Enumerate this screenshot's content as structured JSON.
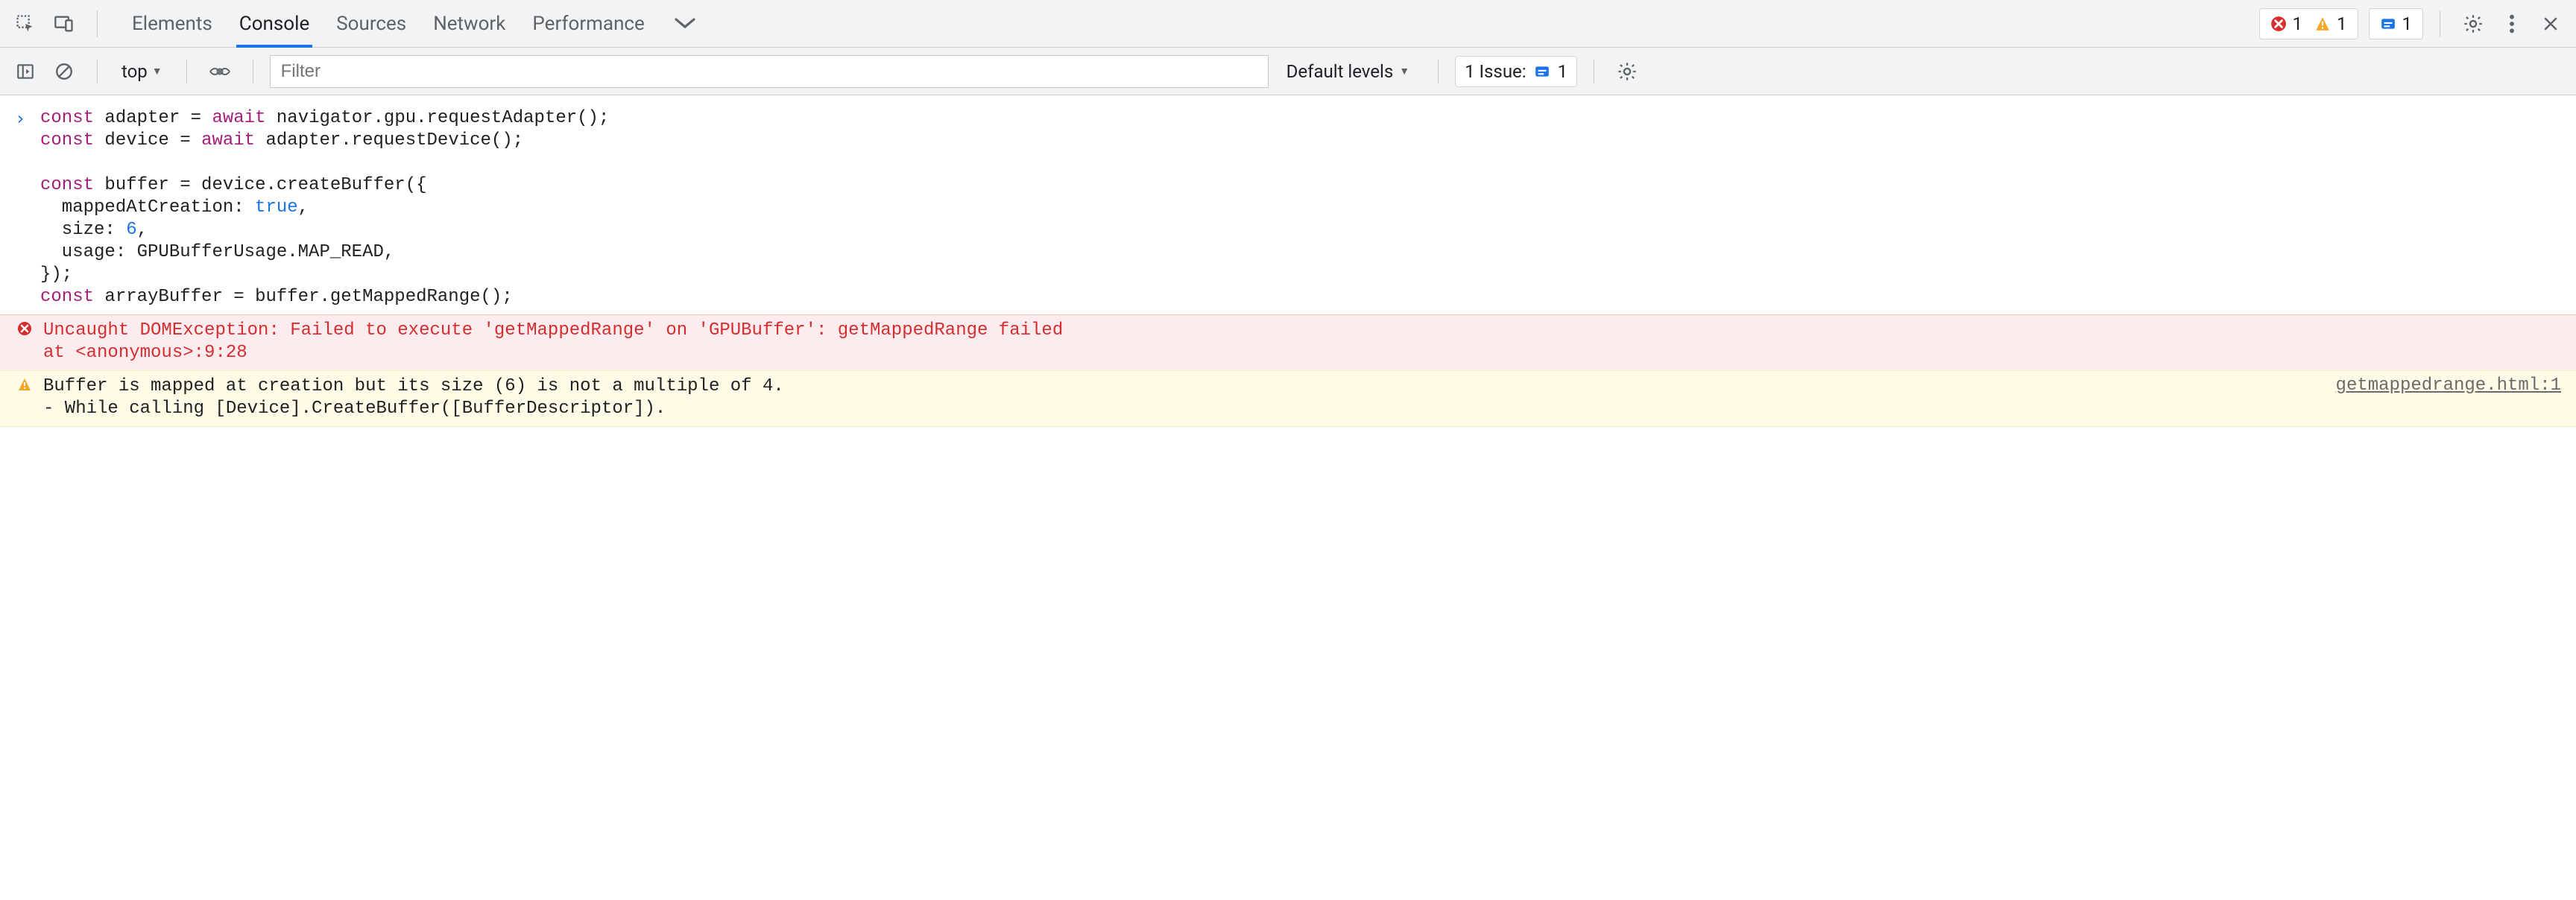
{
  "topbar": {
    "tabs": {
      "elements": "Elements",
      "console": "Console",
      "sources": "Sources",
      "network": "Network",
      "performance": "Performance"
    },
    "counts": {
      "errors": "1",
      "warnings": "1",
      "info": "1"
    }
  },
  "toolbar": {
    "scope": "top",
    "filter_placeholder": "Filter",
    "levels_label": "Default levels",
    "issues_label": "1 Issue:",
    "issues_count": "1"
  },
  "code": {
    "c1": "const",
    "sp": " ",
    "adapter": "adapter",
    "eq": " = ",
    "await": "await",
    "reqAdapter": " navigator.gpu.requestAdapter();",
    "device": "device",
    "reqDevice": " adapter.requestDevice();",
    "buffer": "buffer",
    "createBuf": " = device.createBuffer({",
    "mapLabel": "  mappedAtCreation: ",
    "trueLit": "true",
    "comma": ",",
    "sizeLabel": "  size: ",
    "sizeVal": "6",
    "usageLabel": "  usage: GPUBufferUsage.MAP_READ,",
    "closeBrace": "});",
    "arrayBuffer": "arrayBuffer",
    "getMapped": " = buffer.getMappedRange();"
  },
  "messages": {
    "error_line1": "Uncaught DOMException: Failed to execute 'getMappedRange' on 'GPUBuffer': getMappedRange failed",
    "error_line2": "    at <anonymous>:9:28",
    "warn_line1": "Buffer is mapped at creation but its size (6) is not a multiple of 4.",
    "warn_line2": " - While calling [Device].CreateBuffer([BufferDescriptor]).",
    "warn_src": "getmappedrange.html:1"
  }
}
